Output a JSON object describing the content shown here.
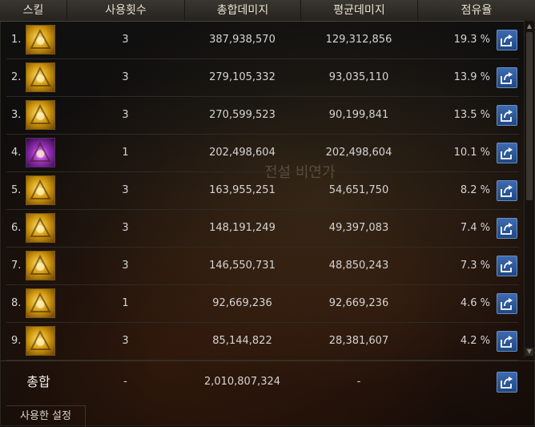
{
  "header": {
    "skill": "스킬",
    "count": "사용횟수",
    "total": "총합데미지",
    "avg": "평균데미지",
    "share": "점유율"
  },
  "rows": [
    {
      "num": "1.",
      "count": "3",
      "total": "387,938,570",
      "avg": "129,312,856",
      "share": "19.3 %",
      "icon": "gold-target-skill-icon"
    },
    {
      "num": "2.",
      "count": "3",
      "total": "279,105,332",
      "avg": "93,035,110",
      "share": "13.9 %",
      "icon": "gold-beast-skill-icon"
    },
    {
      "num": "3.",
      "count": "3",
      "total": "270,599,523",
      "avg": "90,199,841",
      "share": "13.5 %",
      "icon": "gold-burst-skill-icon"
    },
    {
      "num": "4.",
      "count": "1",
      "total": "202,498,604",
      "avg": "202,498,604",
      "share": "10.1 %",
      "icon": "purple-flame-skill-icon"
    },
    {
      "num": "5.",
      "count": "3",
      "total": "163,955,251",
      "avg": "54,651,750",
      "share": "8.2 %",
      "icon": "gold-dragon-skill-icon"
    },
    {
      "num": "6.",
      "count": "3",
      "total": "148,191,249",
      "avg": "49,397,083",
      "share": "7.4 %",
      "icon": "gold-swirl-skill-icon"
    },
    {
      "num": "7.",
      "count": "3",
      "total": "146,550,731",
      "avg": "48,850,243",
      "share": "7.3 %",
      "icon": "gold-cross-skill-icon"
    },
    {
      "num": "8.",
      "count": "1",
      "total": "92,669,236",
      "avg": "92,669,236",
      "share": "4.6 %",
      "icon": "gold-slash-skill-icon"
    },
    {
      "num": "9.",
      "count": "3",
      "total": "85,144,822",
      "avg": "28,381,607",
      "share": "4.2 %",
      "icon": "gold-strike-skill-icon"
    }
  ],
  "total": {
    "label": "총합",
    "count": "-",
    "total": "2,010,807,324",
    "avg": "-"
  },
  "footer": {
    "settings_tab": "사용한 설정"
  },
  "background": {
    "watermark": "전설 비연가"
  },
  "colors": {
    "share_button": "#2a5699",
    "icon_gold": "#d19a10",
    "icon_purple": "#9a2fc0"
  }
}
